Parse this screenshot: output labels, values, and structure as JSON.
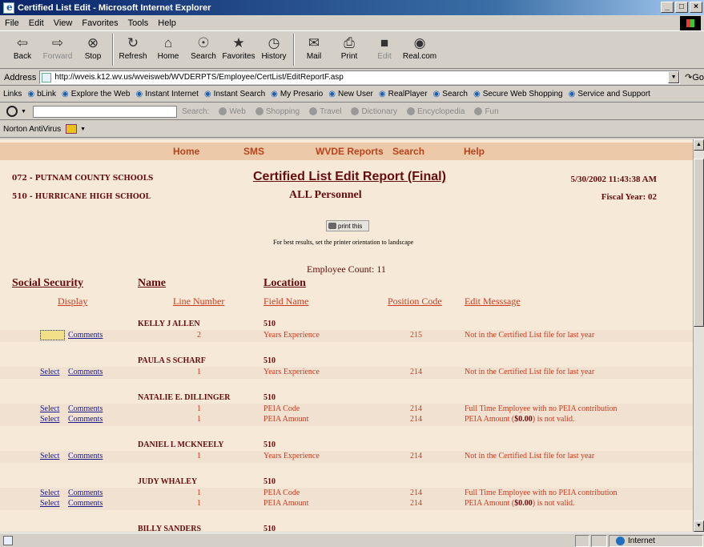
{
  "window": {
    "title": "Certified List Edit - Microsoft Internet Explorer",
    "buttons": [
      "_",
      "□",
      "×"
    ]
  },
  "menu": [
    "File",
    "Edit",
    "View",
    "Favorites",
    "Tools",
    "Help"
  ],
  "toolbar": [
    {
      "label": "Back",
      "icon": "back-arrow-icon",
      "glyph": "⇦"
    },
    {
      "label": "Forward",
      "icon": "forward-arrow-icon",
      "glyph": "⇨"
    },
    {
      "label": "Stop",
      "icon": "stop-icon",
      "glyph": "⊗"
    },
    {
      "label": "Refresh",
      "icon": "refresh-icon",
      "glyph": "↻"
    },
    {
      "label": "Home",
      "icon": "home-icon",
      "glyph": "⌂"
    },
    {
      "label": "Search",
      "icon": "search-icon",
      "glyph": "☉"
    },
    {
      "label": "Favorites",
      "icon": "favorites-icon",
      "glyph": "★"
    },
    {
      "label": "History",
      "icon": "history-icon",
      "glyph": "◷"
    },
    {
      "label": "Mail",
      "icon": "mail-icon",
      "glyph": "✉"
    },
    {
      "label": "Print",
      "icon": "print-icon",
      "glyph": "⎙"
    },
    {
      "label": "Edit",
      "icon": "edit-icon",
      "glyph": "■"
    },
    {
      "label": "Real.com",
      "icon": "real-icon",
      "glyph": "◉"
    }
  ],
  "address": {
    "label": "Address",
    "url": "http://wveis.k12.wv.us/wveisweb/WVDERPTS/Employee/CertList/EditReportF.asp",
    "go": "Go"
  },
  "links": {
    "label": "Links",
    "items": [
      "bLink",
      "Explore the Web",
      "Instant Internet",
      "Instant Search",
      "My Presario",
      "New User",
      "RealPlayer",
      "Search",
      "Secure Web Shopping",
      "Service and Support"
    ]
  },
  "searchbar": {
    "search_label": "Search:",
    "items": [
      "Web",
      "Shopping",
      "Travel",
      "Dictionary",
      "Encyclopedia",
      "Fun"
    ]
  },
  "norton": {
    "label": "Norton AntiVirus"
  },
  "nav": {
    "home": "Home",
    "sms": "SMS",
    "wvde": "WVDE Reports",
    "search": "Search",
    "help": "Help"
  },
  "report": {
    "district": "072 - PUTNAM COUNTY SCHOOLS",
    "school": "510 - HURRICANE HIGH SCHOOL",
    "title": "Certified List Edit Report (Final)",
    "subtitle": "ALL Personnel",
    "datetime": "5/30/2002 11:43:38 AM",
    "fiscal": "Fiscal Year: 02",
    "print_label": "print this",
    "print_note": "For best results, set the printer orientation to landscape",
    "employee_count": "Employee Count:  11"
  },
  "columns": {
    "ssn": "Social Security",
    "name": "Name",
    "location": "Location",
    "display": "Display",
    "line_number": "Line Number",
    "field_name": "Field Name",
    "position_code": "Position Code",
    "edit_message": "Edit Messsage"
  },
  "employees": [
    {
      "name": "KELLY J ALLEN",
      "location": "510",
      "rows": [
        {
          "select": "",
          "comments": "Comments",
          "line": "2",
          "field": "Years Experience",
          "code": "215",
          "msg_pre": "Not in the Certified List file for last year",
          "msg_bold": "",
          "msg_post": ""
        }
      ]
    },
    {
      "name": "PAULA S SCHARF",
      "location": "510",
      "rows": [
        {
          "select": "Select",
          "comments": "Comments",
          "line": "1",
          "field": "Years Experience",
          "code": "214",
          "msg_pre": "Not in the Certified List file for last year",
          "msg_bold": "",
          "msg_post": ""
        }
      ]
    },
    {
      "name": "NATALIE E. DILLINGER",
      "location": "510",
      "rows": [
        {
          "select": "Select",
          "comments": "Comments",
          "line": "1",
          "field": "PEIA Code",
          "code": "214",
          "msg_pre": "Full Time Employee with no PEIA contribution",
          "msg_bold": "",
          "msg_post": ""
        },
        {
          "select": "Select",
          "comments": "Comments",
          "line": "1",
          "field": "PEIA Amount",
          "code": "214",
          "msg_pre": "PEIA Amount (",
          "msg_bold": "$0.00",
          "msg_post": ") is not valid."
        }
      ]
    },
    {
      "name": "DANIEL L MCKNEELY",
      "location": "510",
      "rows": [
        {
          "select": "Select",
          "comments": "Comments",
          "line": "1",
          "field": "Years Experience",
          "code": "214",
          "msg_pre": "Not in the Certified List file for last year",
          "msg_bold": "",
          "msg_post": ""
        }
      ]
    },
    {
      "name": "JUDY  WHALEY",
      "location": "510",
      "rows": [
        {
          "select": "Select",
          "comments": "Comments",
          "line": "1",
          "field": "PEIA Code",
          "code": "214",
          "msg_pre": "Full Time Employee with no PEIA contribution",
          "msg_bold": "",
          "msg_post": ""
        },
        {
          "select": "Select",
          "comments": "Comments",
          "line": "1",
          "field": "PEIA Amount",
          "code": "214",
          "msg_pre": "PEIA Amount (",
          "msg_bold": "$0.00",
          "msg_post": ") is not valid."
        }
      ]
    },
    {
      "name": "BILLY SANDERS",
      "location": "510",
      "rows": []
    }
  ],
  "status": {
    "zone": "Internet"
  }
}
